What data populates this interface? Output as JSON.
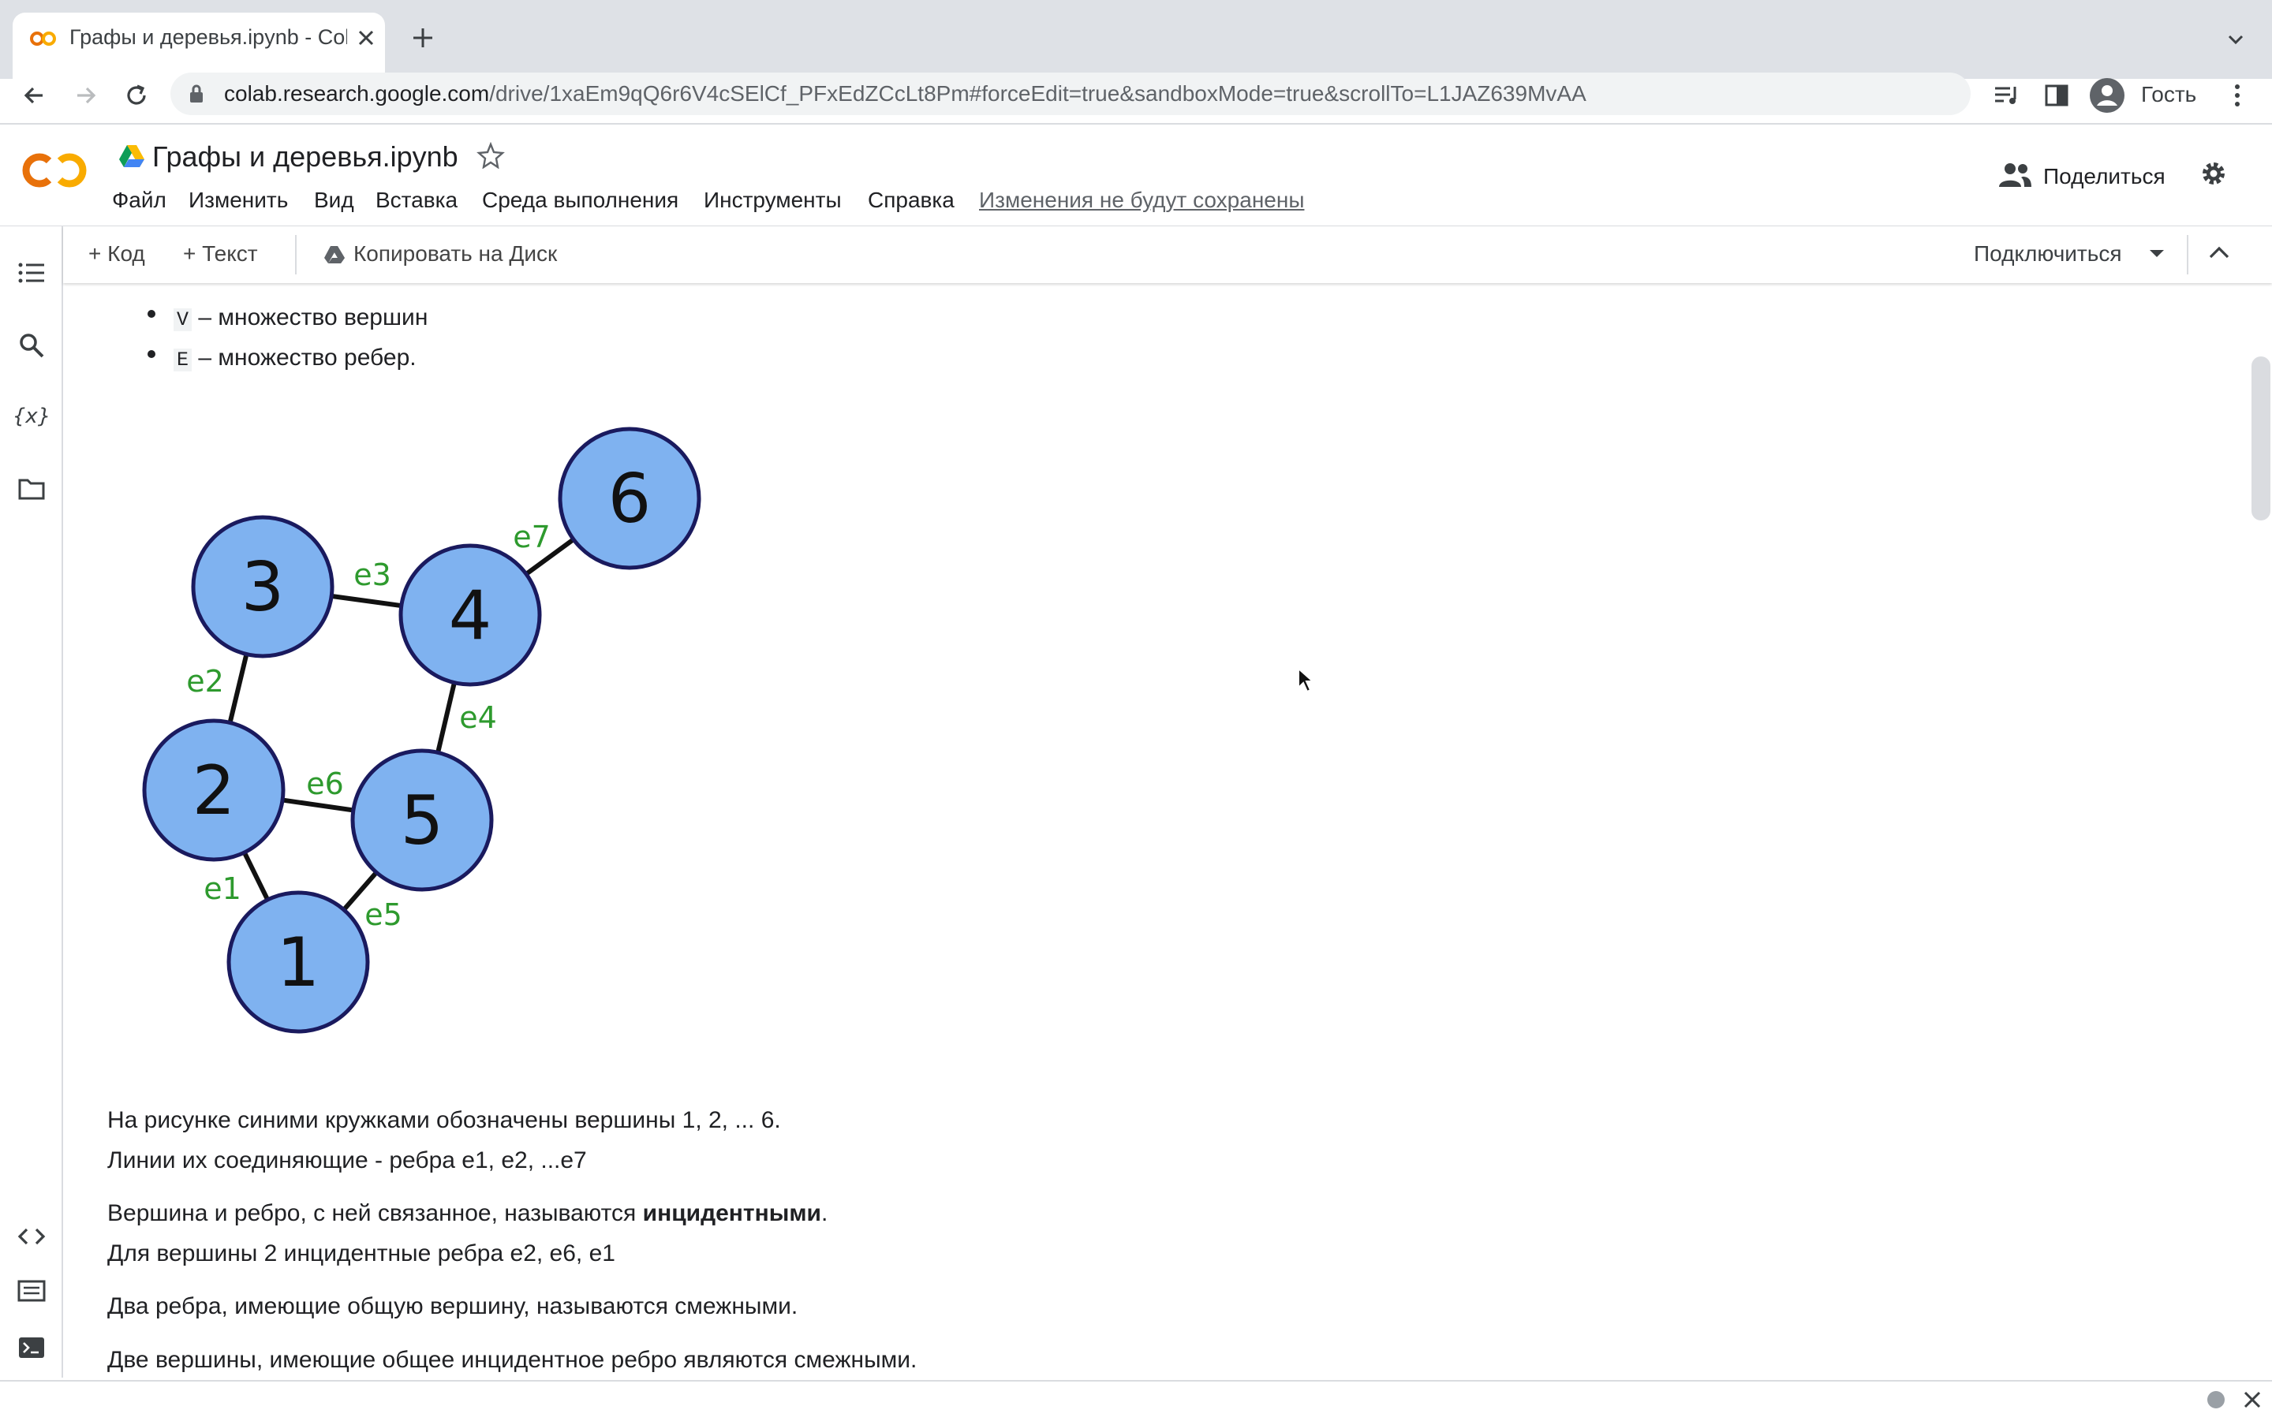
{
  "browser": {
    "tab_title": "Графы и деревья.ipynb - Cola",
    "url_host": "colab.research.google.com",
    "url_path": "/drive/1xaEm9qQ6r6V4cSElCf_PFxEdZCcLt8Pm#forceEdit=true&sandboxMode=true&scrollTo=L1JAZ639MvAA",
    "profile_label": "Гость"
  },
  "header": {
    "logo_text": "CO",
    "doc_title": "Графы и деревья.ipynb",
    "menu": [
      "Файл",
      "Изменить",
      "Вид",
      "Вставка",
      "Среда выполнения",
      "Инструменты",
      "Справка"
    ],
    "unsaved_notice": "Изменения не будут сохранены",
    "share_label": "Поделиться"
  },
  "cell_toolbar": {
    "add_code": "+ Код",
    "add_text": "+ Текст",
    "copy_to_drive": "Копировать на Диск",
    "connect": "Подключиться"
  },
  "content": {
    "bullets": [
      {
        "code": "V",
        "text": " – множество вершин"
      },
      {
        "code": "E",
        "text": " – множество ребер."
      }
    ],
    "graph": {
      "vertices": [
        "1",
        "2",
        "3",
        "4",
        "5",
        "6"
      ],
      "edges": [
        {
          "label": "e1",
          "from": "1",
          "to": "2"
        },
        {
          "label": "e2",
          "from": "2",
          "to": "3"
        },
        {
          "label": "e3",
          "from": "3",
          "to": "4"
        },
        {
          "label": "e4",
          "from": "4",
          "to": "5"
        },
        {
          "label": "e5",
          "from": "1",
          "to": "5"
        },
        {
          "label": "e6",
          "from": "2",
          "to": "5"
        },
        {
          "label": "e7",
          "from": "4",
          "to": "6"
        }
      ],
      "vertex_fill": "#7fb2f0",
      "edge_label_color": "#2e9a2e"
    },
    "paragraphs": [
      "На рисунке синими кружками обозначены вершины 1, 2, ... 6.",
      "Линии их соединяющие - ребра e1, e2, ...e7",
      "Вершина и ребро, с ней связанное, называются ",
      "Для вершины 2 инцидентные ребра e2, e6, e1",
      "Два ребра, имеющие общую вершину, называются смежными.",
      "Две вершины, имеющие общее инцидентное ребро являются смежными."
    ],
    "bold_term": "инцидентными",
    "bold_term_suffix": "."
  },
  "colors": {
    "colab_orange": "#f9ab00",
    "colab_dark_orange": "#e8710a",
    "drive_blue": "#4285f4"
  }
}
